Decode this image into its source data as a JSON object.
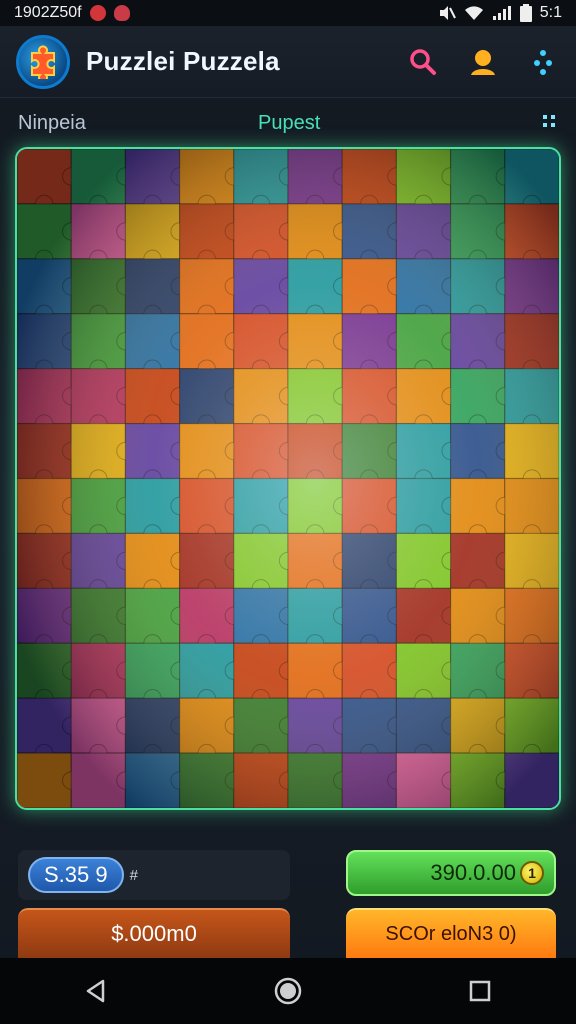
{
  "status_bar": {
    "time_left": "1902Z50f",
    "time_right": "5:1"
  },
  "header": {
    "title": "Puzzlei Puzzela",
    "icons": [
      "search-icon",
      "profile-icon",
      "more-icon"
    ]
  },
  "subbar": {
    "left_label": "Ninpeia",
    "center_label": "Pupest",
    "right_icon": "grid-icon"
  },
  "board": {
    "rows": 12,
    "cols": 10
  },
  "bottom": {
    "balance": "S.35 9",
    "balance_tag": "#",
    "score": "390.0.00",
    "score_coin": "1",
    "buy_label": "$.000m0",
    "action_label": "SCOr eloN3 0)"
  },
  "colors": {
    "accent_green": "#49e1a0",
    "accent_orange": "#ff8a16",
    "accent_blue": "#3b82d8"
  },
  "navbar": {
    "items": [
      "back-icon",
      "home-icon",
      "recents-icon"
    ]
  }
}
